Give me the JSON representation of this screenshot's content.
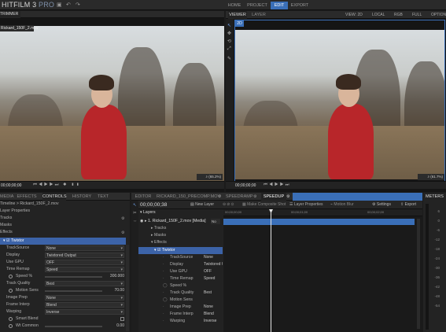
{
  "app": {
    "name": "HITFILM 3",
    "edition": "PRO"
  },
  "nav": {
    "tabs": [
      "HOME",
      "PROJECT",
      "EDIT",
      "EXPORT"
    ],
    "active": "EDIT"
  },
  "trimmer": {
    "tab": "TRIMMER",
    "file": "Rickard_150F_2.mov",
    "timecode": "00;00;00;00",
    "zoom": "(65.2%)"
  },
  "viewer": {
    "tabs": [
      "VIEWER",
      "LAYER"
    ],
    "mode": "2D",
    "view": "VIEW: 2D",
    "space": "LOCAL",
    "channel": "RGB",
    "quality": "FULL",
    "options": "OPTIONS",
    "timecode": "00;00;00;00",
    "zoom": "(61.7%)"
  },
  "controls": {
    "tabs": [
      "MEDIA",
      "EFFECTS",
      "CONTROLS",
      "HISTORY",
      "TEXT"
    ],
    "active": "CONTROLS",
    "path": "Timeline > Rickard_150F_2.mov",
    "sections": [
      "Layer Properties",
      "Tracks",
      "Masks",
      "Effects"
    ],
    "effect": "Twixtor",
    "props": [
      {
        "label": "TrackSource",
        "value": "None",
        "type": "dd"
      },
      {
        "label": "Display",
        "value": "Twixtored Output",
        "type": "dd"
      },
      {
        "label": "Use GPU",
        "value": "OFF",
        "type": "dd"
      },
      {
        "label": "Time Remap",
        "value": "Speed",
        "type": "dd"
      },
      {
        "label": "Speed %",
        "value": "300.000",
        "type": "slider"
      },
      {
        "label": "Track Quality",
        "value": "Best",
        "type": "dd"
      },
      {
        "label": "Motion Sens",
        "value": "70.00",
        "type": "slider"
      },
      {
        "label": "Image Prep",
        "value": "None",
        "type": "dd"
      },
      {
        "label": "Frame Interp",
        "value": "Blend",
        "type": "dd"
      },
      {
        "label": "Warping",
        "value": "Inverse",
        "type": "dd"
      },
      {
        "label": "Smart Blend",
        "value": "",
        "type": "check"
      },
      {
        "label": "Wt Common",
        "value": "0.00",
        "type": "slider"
      }
    ]
  },
  "editor": {
    "tabs": [
      "EDITOR",
      "RICKARD_150_PRECOMP.MOV",
      "SPEEDRAMP",
      "SPEEDUP"
    ],
    "active": "SPEEDUP",
    "timecode": "00;00;00;38",
    "new_layer": "New Layer",
    "make_composite": "Make Composite Shot",
    "layer_properties": "Layer Properties",
    "motion_blur": "Motion Blur",
    "settings": "Settings",
    "export": "Export",
    "layers_header": "Layers",
    "layer_name": "1. Rickard_150F_2.mov [Media]",
    "blend": "No",
    "ruler": [
      "00;00;00;00",
      "00;00;01;00",
      "00;00;02;00"
    ],
    "tree": [
      "Tracks",
      "Masks",
      "Effects"
    ],
    "effect": "Twixtor",
    "props": [
      {
        "label": "TrackSource",
        "value": "None"
      },
      {
        "label": "Display",
        "value": "Twixtored Ou"
      },
      {
        "label": "Use GPU",
        "value": "OFF"
      },
      {
        "label": "Time Remap",
        "value": "Speed"
      },
      {
        "label": "Speed %",
        "value": ""
      },
      {
        "label": "Track Quality",
        "value": "Best"
      },
      {
        "label": "Motion Sens",
        "value": ""
      },
      {
        "label": "Image Prep",
        "value": "None"
      },
      {
        "label": "Frame Interp",
        "value": "Blend"
      },
      {
        "label": "Warping",
        "value": "Inverse"
      }
    ]
  },
  "meters": {
    "title": "METERS",
    "ticks": [
      "6",
      "0",
      "-6",
      "-12",
      "-18",
      "-24",
      "-30",
      "-36",
      "-42",
      "-48",
      "-54"
    ]
  },
  "colors": {
    "accent": "#3a6fb8",
    "clip": "#3c63a8",
    "hoodie": "#b8262a"
  }
}
